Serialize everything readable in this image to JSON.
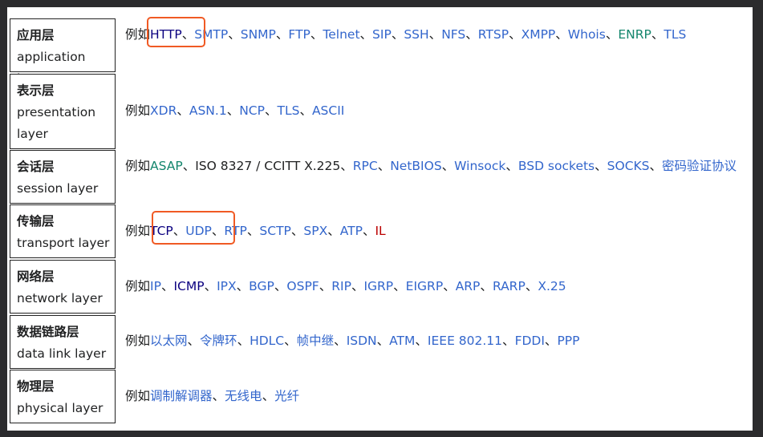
{
  "colors": {
    "link": "#3366cc",
    "visited_link": "#0b0080",
    "green_link": "#14866d",
    "red_link": "#ba0000",
    "text": "#202122",
    "highlight": "#f05a24"
  },
  "rows": [
    {
      "name_cn": "应用层",
      "name_en": "application layer",
      "prefix": "例如",
      "items": [
        {
          "text": "HTTP",
          "color": "#0b0080"
        },
        {
          "text": "SMTP",
          "color": "#3366cc"
        },
        {
          "text": "SNMP",
          "color": "#3366cc"
        },
        {
          "text": "FTP",
          "color": "#3366cc"
        },
        {
          "text": "Telnet",
          "color": "#3366cc"
        },
        {
          "text": "SIP",
          "color": "#3366cc"
        },
        {
          "text": "SSH",
          "color": "#3366cc"
        },
        {
          "text": "NFS",
          "color": "#3366cc"
        },
        {
          "text": "RTSP",
          "color": "#3366cc"
        },
        {
          "text": "XMPP",
          "color": "#3366cc"
        },
        {
          "text": "Whois",
          "color": "#3366cc"
        },
        {
          "text": "ENRP",
          "color": "#14866d"
        },
        {
          "text": "TLS",
          "color": "#3366cc"
        }
      ]
    },
    {
      "name_cn": "表示层",
      "name_en": "presentation layer",
      "prefix": "例如",
      "items": [
        {
          "text": "XDR",
          "color": "#3366cc"
        },
        {
          "text": "ASN.1",
          "color": "#3366cc"
        },
        {
          "text": "NCP",
          "color": "#3366cc"
        },
        {
          "text": "TLS",
          "color": "#3366cc"
        },
        {
          "text": "ASCII",
          "color": "#3366cc"
        }
      ]
    },
    {
      "name_cn": "会话层",
      "name_en": "session layer",
      "prefix": "例如",
      "items": [
        {
          "text": "ASAP",
          "color": "#14866d"
        },
        {
          "text": "ISO 8327 / CCITT X.225",
          "color": "#202122"
        },
        {
          "text": "RPC",
          "color": "#3366cc"
        },
        {
          "text": "NetBIOS",
          "color": "#3366cc"
        },
        {
          "text": "Winsock",
          "color": "#3366cc"
        },
        {
          "text": "BSD sockets",
          "color": "#3366cc"
        },
        {
          "text": "SOCKS",
          "color": "#3366cc"
        },
        {
          "text": "密码验证协议",
          "color": "#3366cc"
        }
      ]
    },
    {
      "name_cn": "传输层",
      "name_en": "transport layer",
      "prefix": "例如",
      "items": [
        {
          "text": "TCP",
          "color": "#0b0080"
        },
        {
          "text": "UDP",
          "color": "#3366cc"
        },
        {
          "text": "RTP",
          "color": "#3366cc"
        },
        {
          "text": "SCTP",
          "color": "#3366cc"
        },
        {
          "text": "SPX",
          "color": "#3366cc"
        },
        {
          "text": "ATP",
          "color": "#3366cc"
        },
        {
          "text": "IL",
          "color": "#ba0000"
        }
      ]
    },
    {
      "name_cn": "网络层",
      "name_en": "network layer",
      "prefix": "例如",
      "items": [
        {
          "text": "IP",
          "color": "#3366cc"
        },
        {
          "text": "ICMP",
          "color": "#0b0080"
        },
        {
          "text": "IPX",
          "color": "#3366cc"
        },
        {
          "text": "BGP",
          "color": "#3366cc"
        },
        {
          "text": "OSPF",
          "color": "#3366cc"
        },
        {
          "text": "RIP",
          "color": "#3366cc"
        },
        {
          "text": "IGRP",
          "color": "#3366cc"
        },
        {
          "text": "EIGRP",
          "color": "#3366cc"
        },
        {
          "text": "ARP",
          "color": "#3366cc"
        },
        {
          "text": "RARP",
          "color": "#3366cc"
        },
        {
          "text": "X.25",
          "color": "#3366cc"
        }
      ]
    },
    {
      "name_cn": "数据链路层",
      "name_en": "data link layer",
      "prefix": "例如",
      "items": [
        {
          "text": "以太网",
          "color": "#3366cc"
        },
        {
          "text": "令牌环",
          "color": "#3366cc"
        },
        {
          "text": "HDLC",
          "color": "#3366cc"
        },
        {
          "text": "帧中继",
          "color": "#3366cc"
        },
        {
          "text": "ISDN",
          "color": "#3366cc"
        },
        {
          "text": "ATM",
          "color": "#3366cc"
        },
        {
          "text": "IEEE 802.11",
          "color": "#3366cc"
        },
        {
          "text": "FDDI",
          "color": "#3366cc"
        },
        {
          "text": "PPP",
          "color": "#3366cc"
        }
      ]
    },
    {
      "name_cn": "物理层",
      "name_en": "physical layer",
      "prefix": "例如",
      "items": [
        {
          "text": "调制解调器",
          "color": "#3366cc"
        },
        {
          "text": "无线电",
          "color": "#3366cc"
        },
        {
          "text": "光纤",
          "color": "#3366cc"
        }
      ]
    }
  ],
  "separator": "、"
}
